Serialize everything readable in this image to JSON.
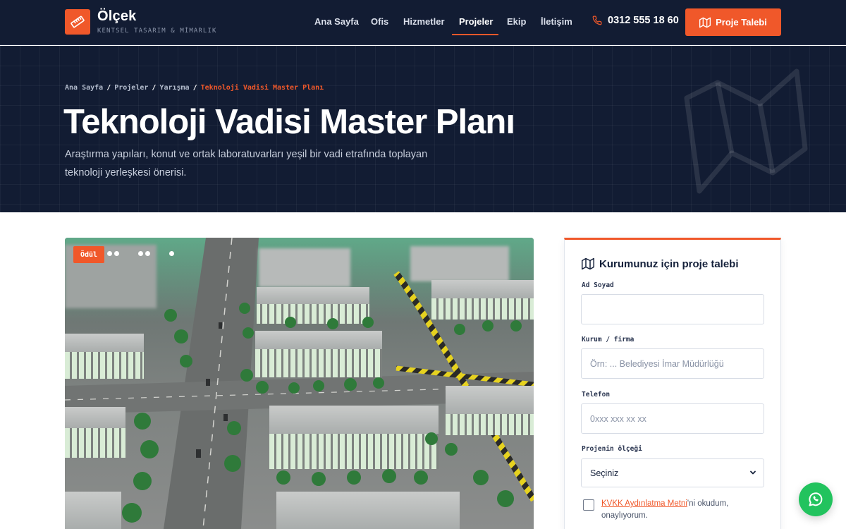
{
  "brand": {
    "name": "Ölçek",
    "tagline": "KENTSEL TASARIM & MİMARLIK",
    "logo_icon": "ruler-icon",
    "accent": "#f0582a",
    "dark": "#121c33"
  },
  "nav": {
    "items": [
      {
        "label": "Ana Sayfa",
        "active": false
      },
      {
        "label": "Ofis",
        "active": false
      },
      {
        "label": "Hizmetler",
        "active": false
      },
      {
        "label": "Projeler",
        "active": true
      },
      {
        "label": "Ekip",
        "active": false
      },
      {
        "label": "İletişim",
        "active": false
      }
    ],
    "phone": {
      "icon": "phone-icon",
      "number": "0312 555 18 60"
    },
    "cta": {
      "icon": "map-icon",
      "label": "Proje Talebi"
    }
  },
  "hero": {
    "breadcrumb": [
      "Ana Sayfa",
      "Projeler",
      "Yarışma",
      "Teknoloji Vadisi Master Planı"
    ],
    "title": "Teknoloji Vadisi Master Planı",
    "subtitle": "Araştırma yapıları, konut ve ortak laboratuvarları yeşil bir vadi etrafında toplayan teknoloji yerleşkesi önerisi.",
    "decoration_icon": "map-icon"
  },
  "project": {
    "image_subject": "architectural scale model of a technology campus",
    "badge": "Ödül",
    "gallery_dots": 5
  },
  "form": {
    "title": "Kurumunuz için proje talebi",
    "title_icon": "map-icon",
    "fields": [
      {
        "label": "Ad Soyad",
        "placeholder": ""
      },
      {
        "label": "Kurum / firma",
        "placeholder": "Örn: ... Belediyesi İmar Müdürlüğü"
      },
      {
        "label": "Telefon",
        "placeholder": "0xxx xxx xx xx"
      }
    ],
    "scale": {
      "label": "Projenin ölçeği",
      "selected": "Seçiniz"
    },
    "consent": {
      "link": "KVKK Aydınlatma Metni",
      "suffix": "'ni okudum, onaylıyorum."
    }
  },
  "whatsapp": {
    "icon": "whatsapp-icon"
  }
}
